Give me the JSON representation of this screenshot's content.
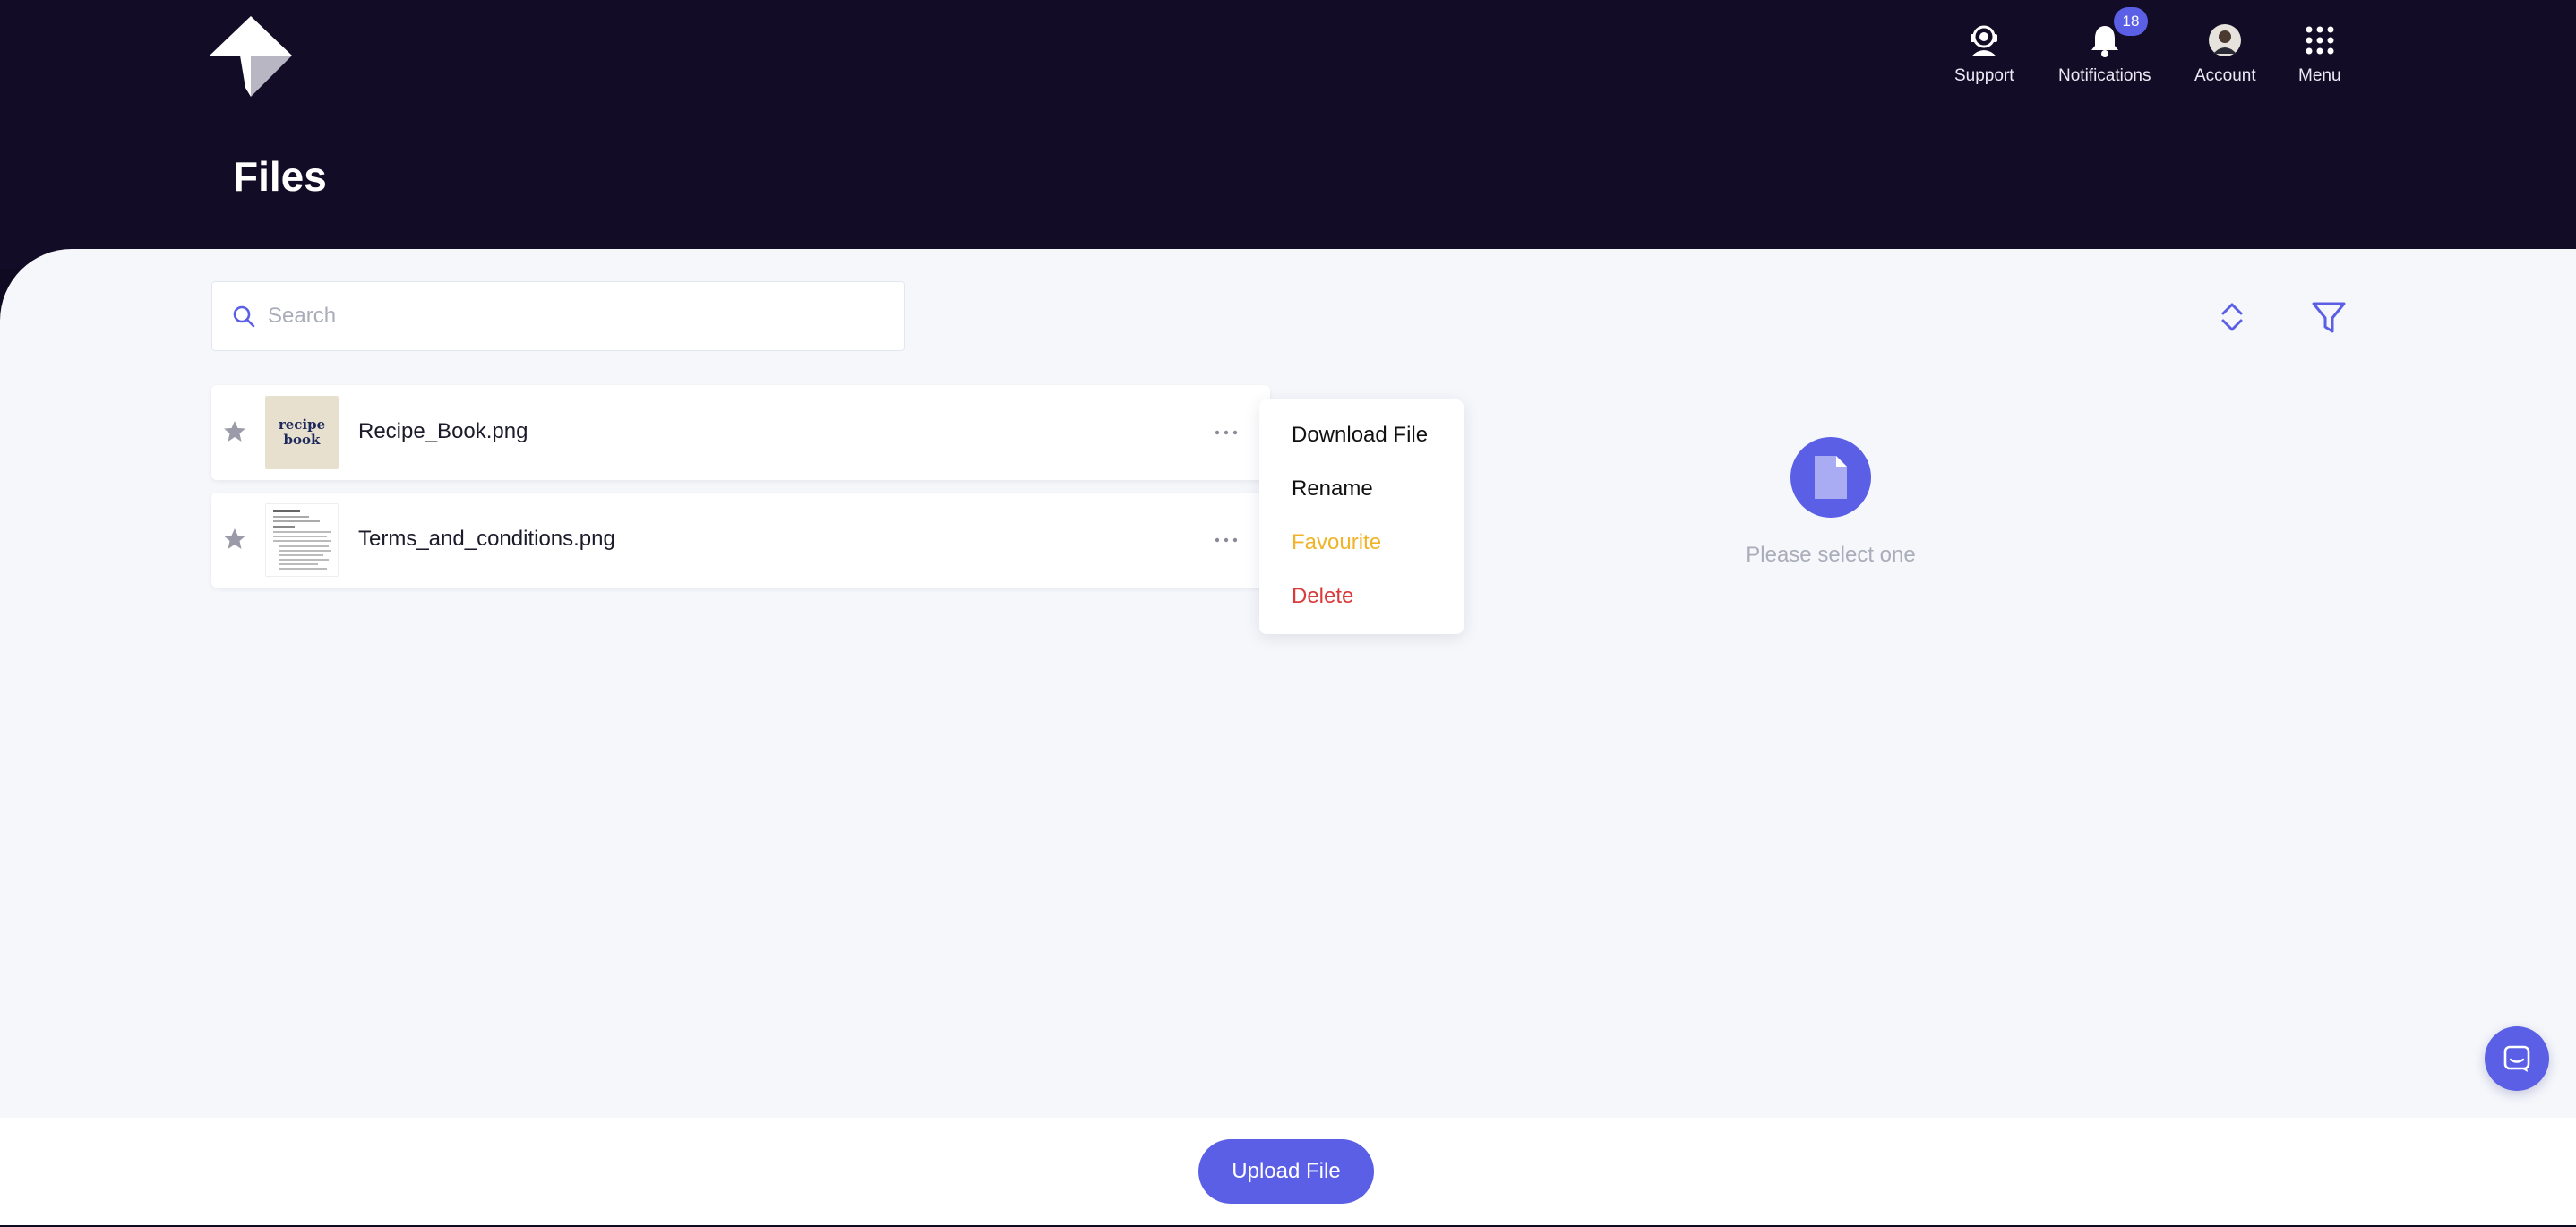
{
  "header": {
    "page_title": "Files",
    "nav": [
      {
        "label": "Support",
        "icon": "support-icon"
      },
      {
        "label": "Notifications",
        "icon": "bell-icon",
        "badge": "18"
      },
      {
        "label": "Account",
        "icon": "avatar"
      },
      {
        "label": "Menu",
        "icon": "grid-icon"
      }
    ]
  },
  "search": {
    "placeholder": "Search"
  },
  "files": [
    {
      "name": "Recipe_Book.png",
      "thumb_line1": "recipe",
      "thumb_line2": "book"
    },
    {
      "name": "Terms_and_conditions.png"
    }
  ],
  "context_menu": {
    "download": "Download File",
    "rename": "Rename",
    "favourite": "Favourite",
    "delete": "Delete"
  },
  "empty_state": {
    "text": "Please select one"
  },
  "footer": {
    "upload_label": "Upload File"
  },
  "colors": {
    "header_bg": "#130c26",
    "accent": "#5b5fe6",
    "favourite": "#f0b429",
    "delete": "#d93a3a"
  }
}
